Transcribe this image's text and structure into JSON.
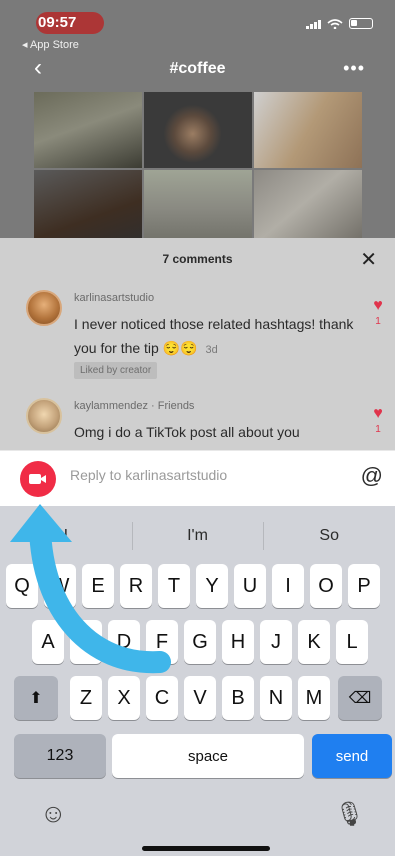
{
  "status": {
    "time": "09:57",
    "back_app": "◂ App Store"
  },
  "nav": {
    "back_symbol": "‹",
    "title": "#coffee",
    "more_symbol": "•••"
  },
  "comments_sheet": {
    "title": "7 comments",
    "close_symbol": "✕",
    "comments": [
      {
        "user": "karlinasartstudio",
        "text": "I never noticed those related hashtags! thank you for the tip 😌😌",
        "time": "3d",
        "badge": "Liked by creator",
        "likes": "1"
      },
      {
        "user": "kaylammendez · Friends",
        "text": "Omg i do a TikTok post all about you",
        "likes": "1"
      }
    ]
  },
  "reply": {
    "placeholder": "Reply to karlinasartstudio",
    "mention_symbol": "@"
  },
  "keyboard": {
    "suggestions": [
      "I",
      "I'm",
      "So"
    ],
    "row1": [
      "Q",
      "W",
      "E",
      "R",
      "T",
      "Y",
      "U",
      "I",
      "O",
      "P"
    ],
    "row2": [
      "A",
      "S",
      "D",
      "F",
      "G",
      "H",
      "J",
      "K",
      "L"
    ],
    "row3": [
      "Z",
      "X",
      "C",
      "V",
      "B",
      "N",
      "M"
    ],
    "shift_symbol": "⬆",
    "delete_symbol": "⌫",
    "numbers_label": "123",
    "space_label": "space",
    "send_label": "send",
    "emoji_symbol": "☺",
    "mic_symbol": "🎙"
  },
  "colors": {
    "accent_red": "#f02c46",
    "send_blue": "#1f7ff0",
    "overlay_arrow": "#3fb6ea"
  },
  "icons": [
    "camera-icon",
    "at-icon",
    "heart-icon",
    "shift-icon",
    "delete-icon",
    "emoji-icon",
    "mic-icon",
    "chevron-left-icon",
    "more-icon",
    "close-icon"
  ]
}
